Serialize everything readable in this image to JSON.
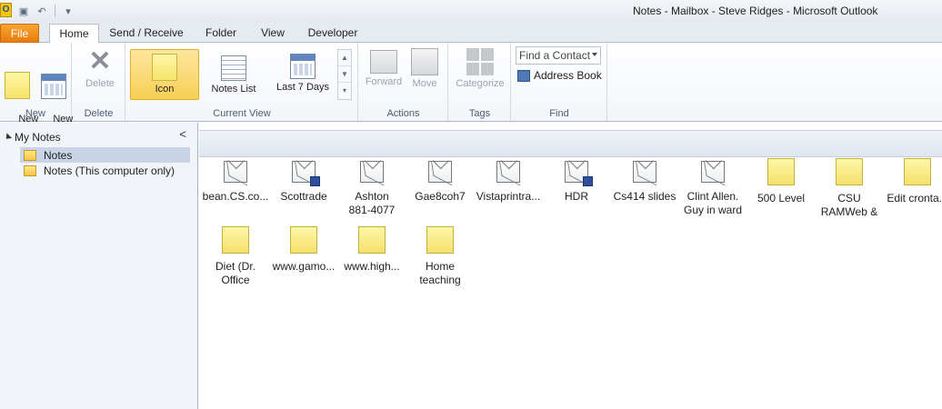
{
  "window": {
    "title": "Notes - Mailbox - Steve Ridges  -  Microsoft Outlook",
    "app_icon_letter": "O"
  },
  "tabs": [
    "File",
    "Home",
    "Send / Receive",
    "Folder",
    "View",
    "Developer"
  ],
  "ribbon": {
    "new_group": {
      "label": "New",
      "new_note": "New\nNote",
      "new_items": "New\nItems ▾"
    },
    "delete_group": {
      "label": "Delete",
      "delete": "Delete"
    },
    "current_view_group": {
      "label": "Current View",
      "icon": "Icon",
      "notes_list": "Notes List",
      "last_7_days": "Last 7 Days"
    },
    "actions_group": {
      "label": "Actions",
      "forward": "Forward",
      "move": "Move"
    },
    "tags_group": {
      "label": "Tags",
      "categorize": "Categorize"
    },
    "find_group": {
      "label": "Find",
      "find_contact": "Find a Contact",
      "address_book": "Address Book"
    }
  },
  "nav": {
    "header": "My Notes",
    "collapse_glyph": "<",
    "items": [
      "Notes",
      "Notes (This computer only)"
    ],
    "selected_index": 0
  },
  "notes": [
    {
      "label": "bean.CS.co...",
      "icon": "envelope-icon"
    },
    {
      "label": "Scottrade",
      "icon": "envelope-attachment-icon"
    },
    {
      "label": "Ashton\n881-4077",
      "icon": "envelope-icon"
    },
    {
      "label": "Gae8coh7",
      "icon": "envelope-icon"
    },
    {
      "label": "Vistaprintra...",
      "icon": "envelope-icon"
    },
    {
      "label": "HDR",
      "icon": "envelope-attachment-icon"
    },
    {
      "label": "Cs414 slides",
      "icon": "envelope-icon"
    },
    {
      "label": "Clint Allen.\nGuy in ward",
      "icon": "envelope-icon"
    },
    {
      "label": "500 Level",
      "icon": "sticky-note-icon"
    },
    {
      "label": "CSU\nRAMWeb &",
      "icon": "sticky-note-icon"
    },
    {
      "label": "Edit cronta...",
      "icon": "sticky-note-icon"
    },
    {
      "label": "Diet (Dr.\nOffice",
      "icon": "sticky-note-icon"
    },
    {
      "label": "www.gamo...",
      "icon": "sticky-note-icon"
    },
    {
      "label": "www.high...",
      "icon": "sticky-note-icon"
    },
    {
      "label": "Home\nteaching",
      "icon": "sticky-note-icon"
    }
  ]
}
